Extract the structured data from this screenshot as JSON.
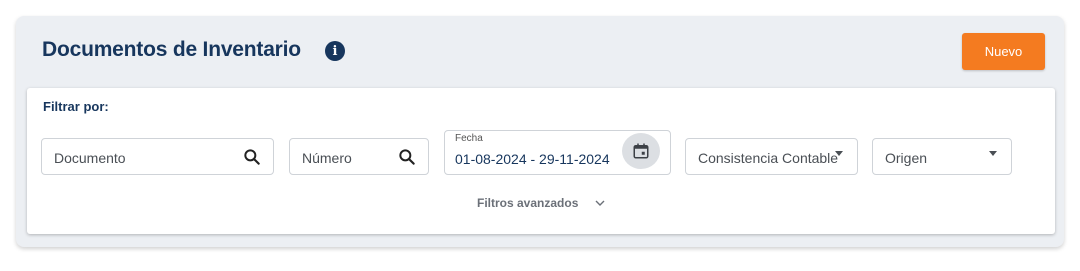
{
  "header": {
    "title": "Documentos de Inventario",
    "info_icon": "info-icon",
    "new_button_label": "Nuevo"
  },
  "filters": {
    "label": "Filtrar por:",
    "documento_placeholder": "Documento",
    "numero_placeholder": "Número",
    "fecha_label": "Fecha",
    "fecha_value": "01-08-2024 - 29-11-2024",
    "consistencia_value": "Consistencia Contable",
    "origen_value": "Origen",
    "advanced_label": "Filtros avanzados"
  },
  "colors": {
    "primary": "#17365d",
    "accent": "#f47b20",
    "panel_bg": "#eceff3"
  }
}
